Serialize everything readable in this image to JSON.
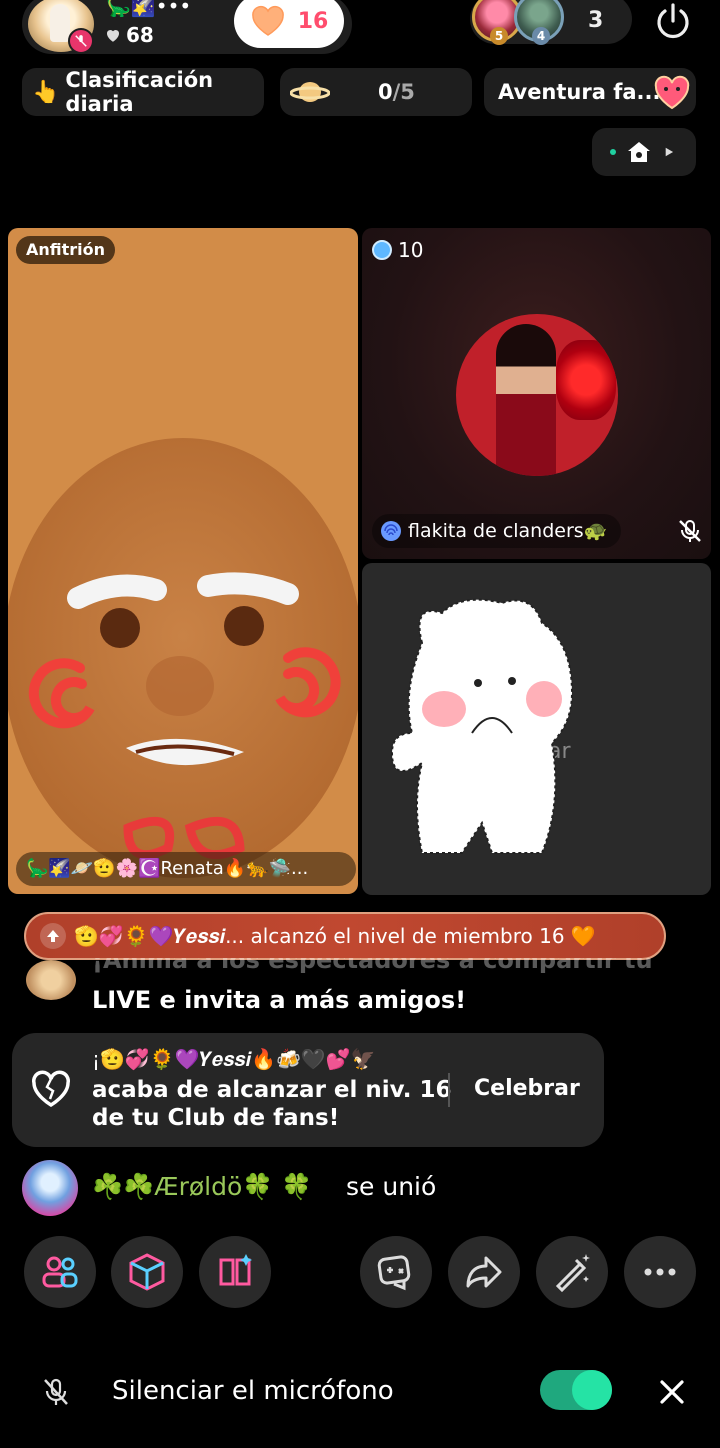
{
  "top": {
    "host_emojis": "🦕🌠•••",
    "likes": "68",
    "follow_count": "16",
    "viewer_levels": [
      "5",
      "4"
    ],
    "viewer_count": "3"
  },
  "row2": {
    "ranking_label": "Clasificación diaria",
    "ranking_icon": "👆",
    "planet_score": "0",
    "planet_total": "/5",
    "adventure_label": "Aventura fa..."
  },
  "host_tile": {
    "label": "Anfitrión",
    "name": "🦕🌠🪐🫡🌸☪️Renata🔥🐆🛸..."
  },
  "guest_tile": {
    "level": "10",
    "name": "flakita de clanders🐢"
  },
  "empty_tile": {
    "text": "ar"
  },
  "level_banner": {
    "text": "🫡💞🌻💜𝒀𝒆𝒔𝒔𝒊... alcanzó el nivel de miembro 16 🧡"
  },
  "chat": {
    "faded_line": "¡Anima a los espectadores a compartir tu",
    "line1": "LIVE e invita a más amigos!",
    "fan_emojis": "¡🫡💞🌻💜𝒀𝒆𝒔𝒔𝒊🔥🍻🖤💕🦅",
    "fan_line1": "acaba de alcanzar el niv. 16",
    "fan_line2": "de tu Club de fans!",
    "celebrate": "Celebrar",
    "join_name": "☘️☘️Ærøldö🍀 🍀",
    "join_verb": "se unió"
  },
  "bottom": {
    "mute_label": "Silenciar el micrófono"
  }
}
